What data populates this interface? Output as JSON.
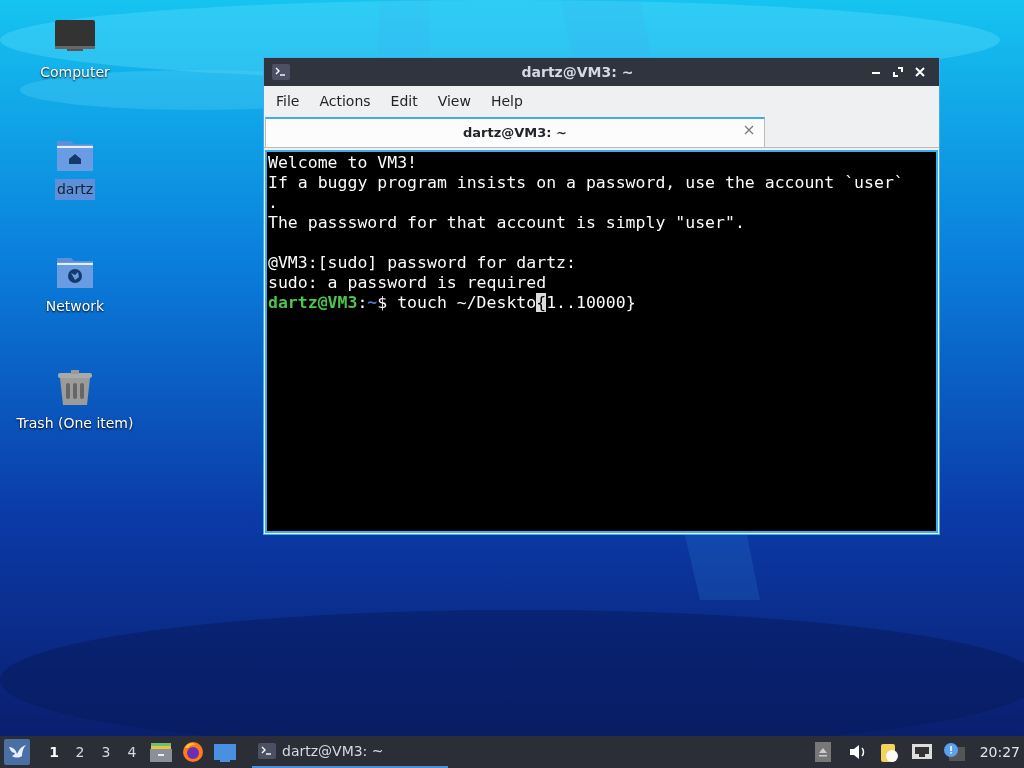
{
  "desktop_icons": [
    {
      "label": "Computer",
      "kind": "computer",
      "selected": false
    },
    {
      "label": "dartz",
      "kind": "home",
      "selected": true
    },
    {
      "label": "Network",
      "kind": "network",
      "selected": false
    },
    {
      "label": "Trash (One item)",
      "kind": "trash",
      "selected": false
    }
  ],
  "window": {
    "title": "dartz@VM3: ~",
    "menu": [
      "File",
      "Actions",
      "Edit",
      "View",
      "Help"
    ],
    "tabs": [
      {
        "label": "dartz@VM3: ~",
        "selected": true
      }
    ],
    "terminal_lines": [
      {
        "kind": "text",
        "segments": [
          {
            "kind": "plain",
            "text": "Welcome to VM3!"
          }
        ]
      },
      {
        "kind": "text",
        "segments": [
          {
            "kind": "plain",
            "text": "If a buggy program insists on a password, use the account `user`"
          }
        ]
      },
      {
        "kind": "text",
        "segments": [
          {
            "kind": "plain",
            "text": "."
          }
        ]
      },
      {
        "kind": "text",
        "segments": [
          {
            "kind": "plain",
            "text": "The passsword for that account is simply \"user\"."
          }
        ]
      },
      {
        "kind": "blank"
      },
      {
        "kind": "text",
        "segments": [
          {
            "kind": "plain",
            "text": "@VM3:[sudo] password for dartz:"
          }
        ]
      },
      {
        "kind": "text",
        "segments": [
          {
            "kind": "plain",
            "text": "sudo: a password is required"
          }
        ]
      },
      {
        "kind": "text",
        "segments": [
          {
            "kind": "user",
            "text": "dartz@VM3"
          },
          {
            "kind": "plain",
            "text": ":"
          },
          {
            "kind": "path",
            "text": "~"
          },
          {
            "kind": "plain",
            "text": "$ touch ~/Deskto"
          },
          {
            "kind": "cursor",
            "text": "{"
          },
          {
            "kind": "plain",
            "text": "1..10000}"
          }
        ]
      }
    ]
  },
  "taskbar": {
    "workspaces": [
      {
        "label": "1",
        "selected": true
      },
      {
        "label": "2",
        "selected": false
      },
      {
        "label": "3",
        "selected": false
      },
      {
        "label": "4",
        "selected": false
      }
    ],
    "launchers": [
      {
        "kind": "files"
      },
      {
        "kind": "browser"
      },
      {
        "kind": "desktop"
      }
    ],
    "tasks": [
      {
        "label": "dartz@VM3: ~",
        "selected": true
      }
    ],
    "tray": [
      {
        "kind": "eject"
      },
      {
        "kind": "volume"
      },
      {
        "kind": "clipboard"
      },
      {
        "kind": "network"
      },
      {
        "kind": "notice"
      }
    ],
    "clock": "20:27"
  }
}
